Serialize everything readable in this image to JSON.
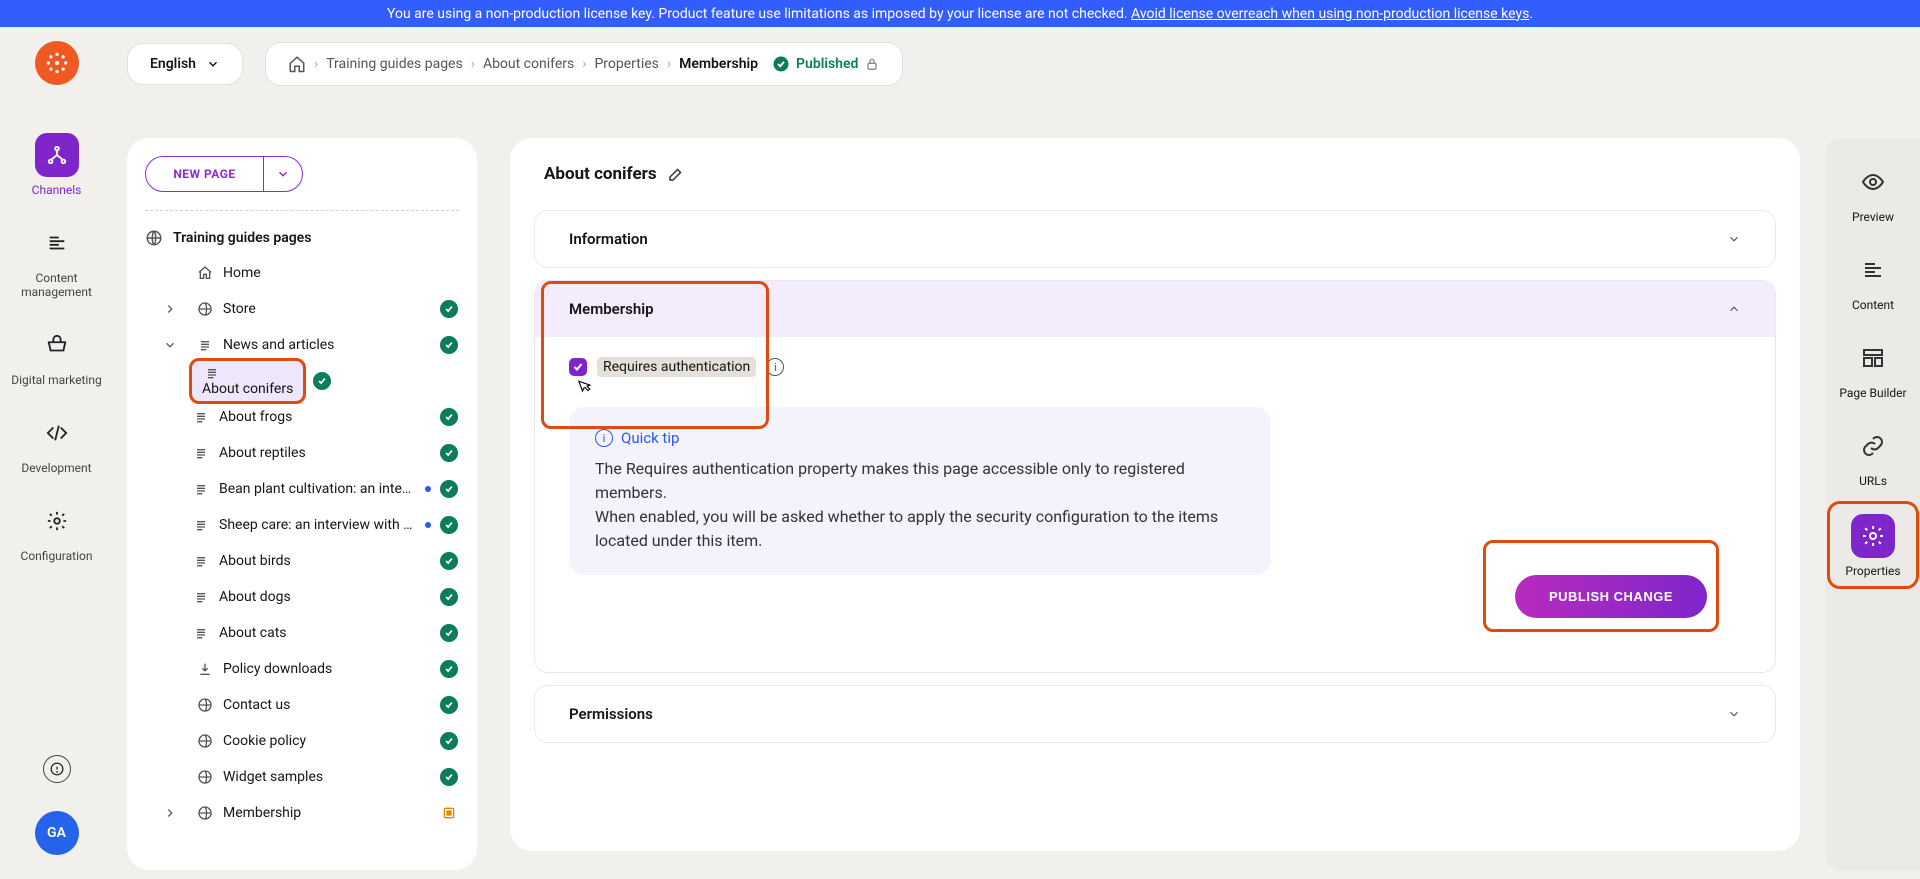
{
  "banner": {
    "prefix": "You are using a non-production license key. Product feature use limitations as imposed by your license are not checked. ",
    "link": "Avoid license overreach when using non-production license keys",
    "suffix": "."
  },
  "language": {
    "current": "English"
  },
  "breadcrumb": {
    "items": [
      {
        "label": "Training guides pages"
      },
      {
        "label": "About conifers"
      },
      {
        "label": "Properties"
      },
      {
        "label": "Membership"
      }
    ],
    "status": "Published"
  },
  "global_nav": {
    "channels": "Channels",
    "content_mgmt": "Content management",
    "digital_marketing": "Digital marketing",
    "development": "Development",
    "configuration": "Configuration"
  },
  "user": {
    "initials": "GA"
  },
  "tree": {
    "new_page": "NEW PAGE",
    "root": "Training guides pages",
    "items": [
      {
        "label": "Home",
        "icon": "home",
        "depth": 1,
        "status": "none",
        "expandable": false
      },
      {
        "label": "Store",
        "icon": "globe",
        "depth": 1,
        "status": "ok",
        "expandable": true
      },
      {
        "label": "News and articles",
        "icon": "doc",
        "depth": 1,
        "status": "ok",
        "expandable": true,
        "expanded": true
      },
      {
        "label": "About conifers",
        "icon": "doc",
        "depth": 2,
        "status": "ok",
        "selected": true
      },
      {
        "label": "About frogs",
        "icon": "doc",
        "depth": 2,
        "status": "ok"
      },
      {
        "label": "About reptiles",
        "icon": "doc",
        "depth": 2,
        "status": "ok"
      },
      {
        "label": "Bean plant cultivation: an interview",
        "icon": "doc",
        "depth": 2,
        "status": "ok",
        "extra": true
      },
      {
        "label": "Sheep care: an interview with a farmer",
        "icon": "doc",
        "depth": 2,
        "status": "ok",
        "extra": true
      },
      {
        "label": "About birds",
        "icon": "doc",
        "depth": 2,
        "status": "ok"
      },
      {
        "label": "About dogs",
        "icon": "doc",
        "depth": 2,
        "status": "ok"
      },
      {
        "label": "About cats",
        "icon": "doc",
        "depth": 2,
        "status": "ok"
      },
      {
        "label": "Policy downloads",
        "icon": "download",
        "depth": 1,
        "status": "ok"
      },
      {
        "label": "Contact us",
        "icon": "globe",
        "depth": 1,
        "status": "ok"
      },
      {
        "label": "Cookie policy",
        "icon": "globe",
        "depth": 1,
        "status": "ok"
      },
      {
        "label": "Widget samples",
        "icon": "globe",
        "depth": 1,
        "status": "ok"
      },
      {
        "label": "Membership",
        "icon": "globe",
        "depth": 1,
        "status": "draft",
        "expandable": true
      }
    ]
  },
  "right_nav": {
    "preview": "Preview",
    "content": "Content",
    "page_builder": "Page Builder",
    "urls": "URLs",
    "properties": "Properties"
  },
  "content": {
    "title": "About conifers",
    "sections": {
      "information": "Information",
      "membership": "Membership",
      "permissions": "Permissions"
    },
    "membership": {
      "checkbox_label": "Requires authentication",
      "tip_title": "Quick tip",
      "tip_body_1": "The Requires authentication property makes this page accessible only to registered members.",
      "tip_body_2": "When enabled, you will be asked whether to apply the security configuration to the items located under this item."
    },
    "publish_btn": "PUBLISH CHANGE"
  }
}
